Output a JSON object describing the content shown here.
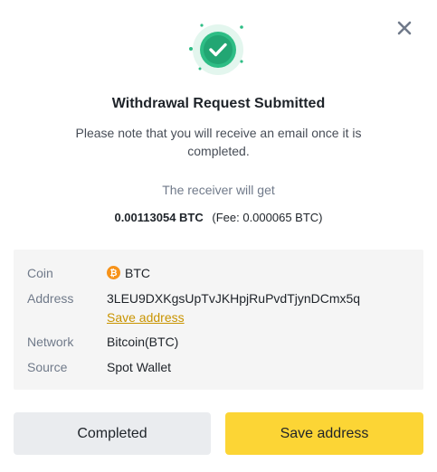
{
  "header": {
    "close_icon": "close-icon",
    "success_icon": "check-circle-icon",
    "accent_color": "#2ebd85"
  },
  "message": {
    "title": "Withdrawal Request Submitted",
    "subtitle": "Please note that you will receive an email once it is completed.",
    "receiver_label": "The receiver will get",
    "amount": "0.00113054 BTC",
    "fee": "(Fee: 0.000065 BTC)"
  },
  "details": {
    "coin": {
      "label": "Coin",
      "value": "BTC",
      "icon": "bitcoin-icon",
      "icon_color": "#f7931a"
    },
    "address": {
      "label": "Address",
      "value": "3LEU9DXKgsUpTvJKHpjRuPvdTjynDCmx5q",
      "link": "Save address"
    },
    "network": {
      "label": "Network",
      "value": "Bitcoin(BTC)"
    },
    "source": {
      "label": "Source",
      "value": "Spot Wallet"
    }
  },
  "actions": {
    "completed_label": "Completed",
    "save_label": "Save address",
    "primary_color": "#fcd535"
  }
}
